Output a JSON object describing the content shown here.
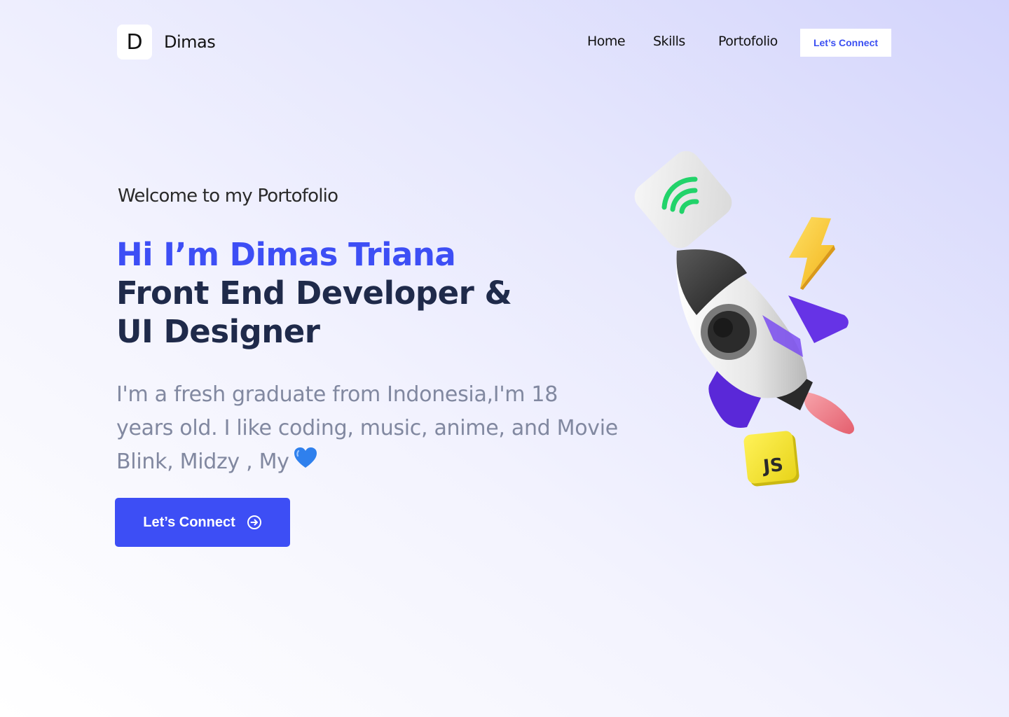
{
  "brand": {
    "logo_letter": "D",
    "name": "Dimas"
  },
  "nav": {
    "links": [
      "Home",
      "Skills",
      "Portofolio"
    ],
    "cta_label": "Let’s Connect"
  },
  "hero": {
    "welcome": "Welcome to my Portofolio",
    "headline_line1": "Hi I’m Dimas Triana",
    "headline_line2": "Front End Developer & UI Designer",
    "description": "I'm a fresh graduate from Indonesia,I'm 18 years old. I like coding, music, anime, and Movie Blink, Midzy , My",
    "cta_label": "Let’s Connect",
    "cta_icon": "arrow-right-circle-icon"
  },
  "illustration": {
    "badge_text": "JS",
    "items": [
      "wifi-tile-icon",
      "lightning-bolt-icon",
      "rocket-icon",
      "js-badge-icon"
    ]
  },
  "colors": {
    "accent": "#3d4ef5",
    "heading": "#1f2a4a",
    "body_text": "#8188a0",
    "rocket_fin": "#6633e6",
    "wifi_green": "#22d36a",
    "bolt_yellow": "#f7c531",
    "js_yellow": "#f6e832",
    "heart_blue": "#2f80ed"
  }
}
